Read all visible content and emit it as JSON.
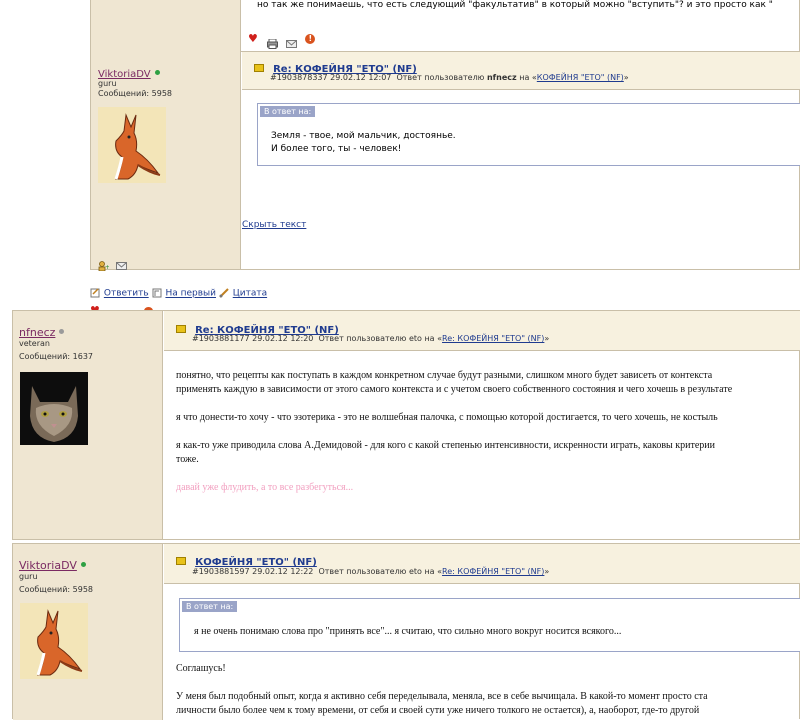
{
  "post0": {
    "top_text": "но так же понимаешь, что есть следующий \"факультатив\" в который можно \"вступить\"? и это просто как \""
  },
  "post1": {
    "username": "ViktoriaDV",
    "rank": "guru",
    "count": "Сообщений: 5958",
    "title": "Re: КОФЕЙНЯ \"ЕТО\" (NF)",
    "meta_id": "#1903878337 29.02.12 12:07",
    "meta_reply": "Ответ пользователю",
    "meta_user": "nfnecz",
    "meta_on": "на «",
    "meta_link": "КОФЕЙНЯ \"ЕТО\" (NF)",
    "meta_close": "»",
    "quote_label": "В ответ на:",
    "quote_line1": "Земля - твое, мой мальчик, достоянье.",
    "quote_line2": "И более того, ты - человек!",
    "hide_text": "Скрыть текст"
  },
  "actions": {
    "reply": "Ответить",
    "first": "На первый",
    "quote": "Цитата"
  },
  "post2": {
    "username": "nfnecz",
    "rank": "veteran",
    "count": "Сообщений: 1637",
    "title": "Re: КОФЕЙНЯ \"ЕТО\" (NF)",
    "meta_id": "#1903881177 29.02.12 12:20",
    "meta_reply": "Ответ пользователю eto на «",
    "meta_link": "Re: КОФЕЙНЯ \"ЕТО\" (NF)",
    "meta_close": "»",
    "p1a": "понятно, что рецепты как поступать в каждом конкретном случае будут разными, слишком много будет зависеть от контекста",
    "p1b": "применять каждую в зависимости от этого самого контекста и с учетом своего собственного состояния и чего хочешь в результате",
    "p2": "я что донести-то хочу - что эзотерика - это не волшебная палочка, с помощью которой достигается, то чего хочешь, не костыль",
    "p3a": "я как-то уже приводила слова А.Демидовой - для кого с какой степенью интенсивности, искренности играть, каковы критерии",
    "p3b": "тоже.",
    "sig": "давай уже флудить, а то все разбегуться..."
  },
  "post3": {
    "username": "ViktoriaDV",
    "rank": "guru",
    "count": "Сообщений: 5958",
    "title": "КОФЕЙНЯ \"ЕТО\" (NF)",
    "meta_id": "#1903881597 29.02.12 12:22",
    "meta_reply": "Ответ пользователю eto на «",
    "meta_link": "Re: КОФЕЙНЯ \"ЕТО\" (NF)",
    "meta_close": "»",
    "quote_label": "В ответ на:",
    "quote_text": "я не очень понимаю слова про \"принять все\"... я считаю, что сильно много вокруг носится всякого...",
    "p1": "Соглашусь!",
    "p2a": "У меня был подобный опыт, когда я активно себя переделывала, меняла, все в себе вычищала. В какой-то момент просто ста",
    "p2b": "личности было более чем к тому времени, от себя и своей сути уже ничего толкого не остается), а, наоборот, где-то другой"
  },
  "colors": {
    "online": "#2ea043",
    "offline": "#9a9a9a",
    "panel": "#efe6d2",
    "signature": "#f2a0c0"
  }
}
